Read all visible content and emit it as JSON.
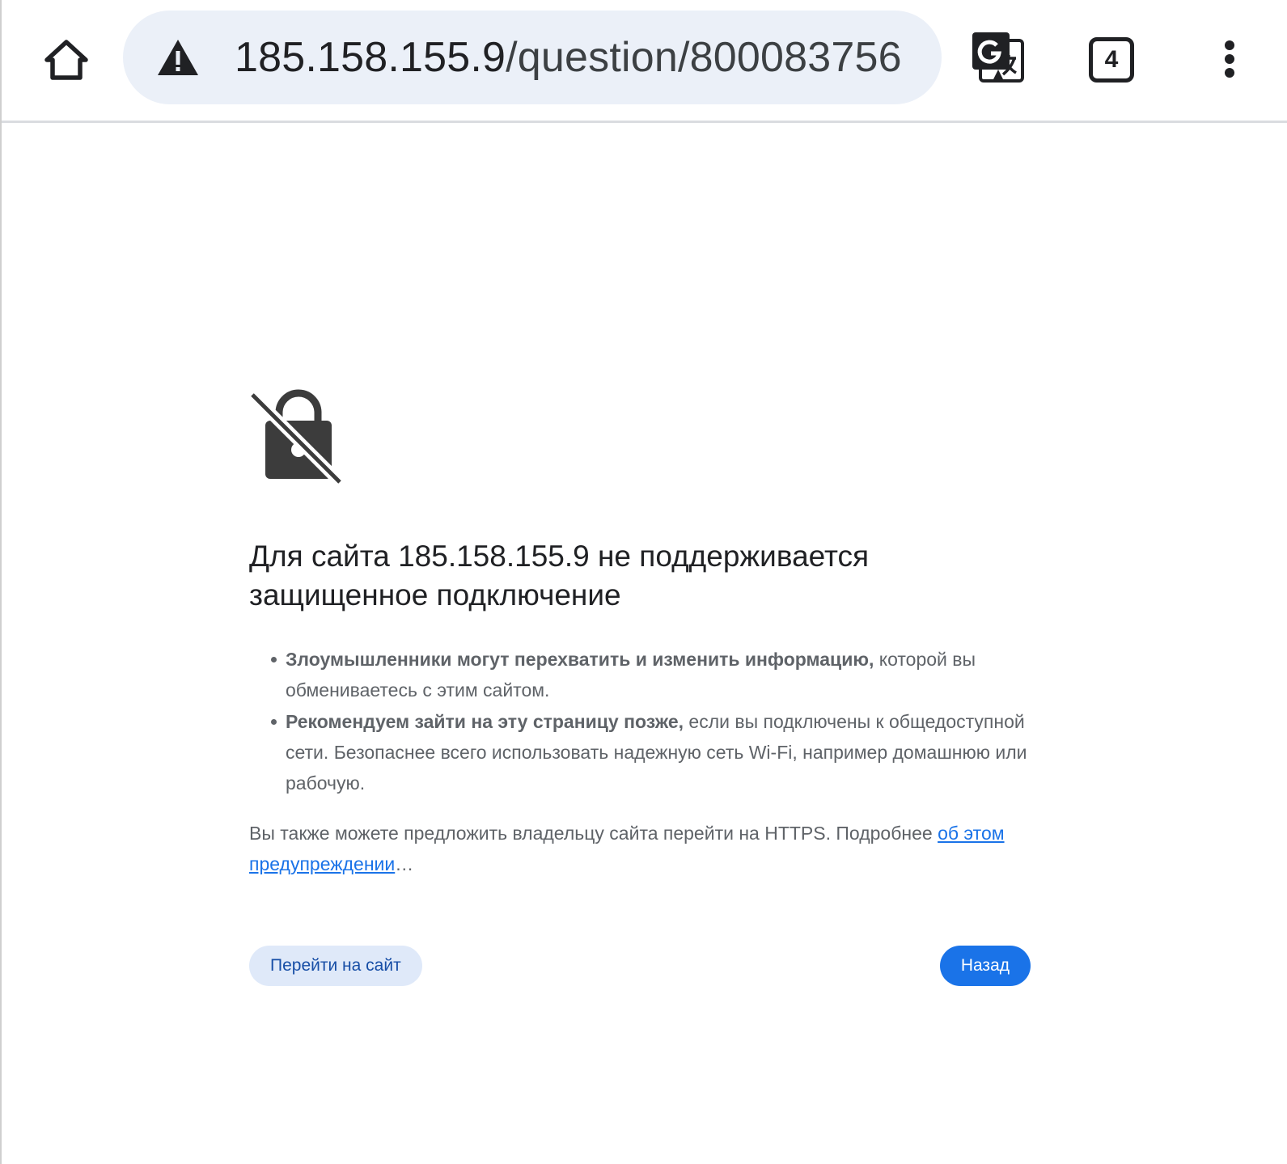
{
  "toolbar": {
    "url_host": "185.158.155.9",
    "url_path": "/question/800083756",
    "tab_count": "4",
    "icons": {
      "home": "home-icon",
      "security": "warning-triangle-icon",
      "translate": "translate-icon",
      "tabs": "tab-switcher-icon",
      "menu": "more-vert-icon"
    }
  },
  "interstitial": {
    "icon": "lock-off-icon",
    "heading": "Для сайта 185.158.155.9 не поддерживается защищенное подключение",
    "bullets": [
      {
        "bold": "Злоумышленники могут перехватить и изменить информацию,",
        "text": " которой вы обмениваетесь с этим сайтом."
      },
      {
        "bold": "Рекомендуем зайти на эту страницу позже,",
        "text": " если вы подключены к общедоступной сети. Безопаснее всего использовать надежную сеть Wi-Fi, например домашнюю или рабочую."
      }
    ],
    "extra_text": "Вы также можете предложить владельцу сайта перейти на HTTPS. Подробнее ",
    "learn_more_link": "об этом предупреждении",
    "ellipsis": "…",
    "proceed_button": "Перейти на сайт",
    "back_button": "Назад"
  },
  "colors": {
    "omnibox_bg": "#ebf0f8",
    "primary_blue": "#1a73e8",
    "secondary_button_bg": "#dfe9f9",
    "icon_dark": "#202124",
    "body_text": "#5f6368"
  }
}
